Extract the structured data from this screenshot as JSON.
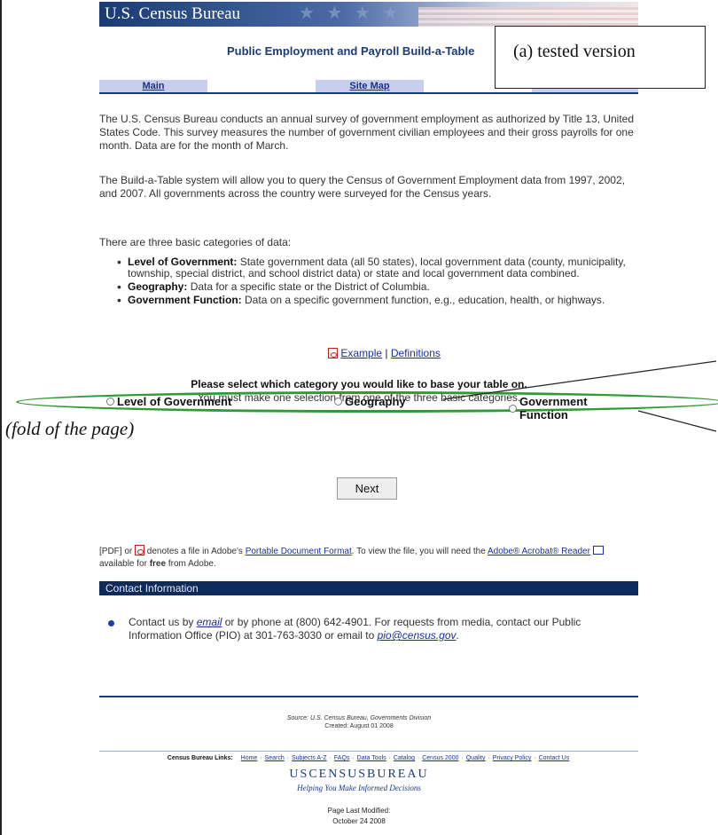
{
  "banner": {
    "title": "U.S. Census Bureau",
    "stars": "★ ★ ★ ★"
  },
  "page_title": "Public Employment and Payroll Build-a-Table",
  "callout": "(a) tested version",
  "nav": {
    "main": "Main",
    "site_map": "Site Map"
  },
  "intro": {
    "p1": "The U.S. Census Bureau conducts an annual survey of government employment as authorized by Title 13, United States Code. This survey measures the number of government civilian employees and their gross payrolls for one month. Data are for the month of March.",
    "p2": "The Build-a-Table system will allow you to query the Census of Government Employment data from 1997, 2002, and 2007. All governments across the country were surveyed for the Census years.",
    "p3": "There are three basic categories of data:"
  },
  "categories": [
    {
      "label": "Level of Government:",
      "text": "State government data (all 50 states), local government data (county, municipality, township, special district, and school district data) or state and local government data combined."
    },
    {
      "label": "Geography:",
      "text": "Data for a specific state or the District of Columbia."
    },
    {
      "label": "Government Function:",
      "text": "Data on a specific government function, e.g., education, health, or highways."
    }
  ],
  "links": {
    "example": "Example",
    "separator": "|",
    "definitions": "Definitions"
  },
  "select": {
    "heading": "Please select which category you would like to base your table on.",
    "sub": "You must make one selection from one of the three basic categories."
  },
  "radios": {
    "level": "Level of Government",
    "geography": "Geography",
    "function": "Government Function"
  },
  "fold_label": "(fold of the page)",
  "next_button": "Next",
  "pdf_note": {
    "prefix": "[PDF] or",
    "mid": "denotes a file in Adobe's",
    "link1": "Portable Document Format",
    "mid2": ". To view the file, you will need the",
    "link2": "Adobe® Acrobat® Reader",
    "suffix_a": "available for",
    "free": "free",
    "suffix_b": "from Adobe."
  },
  "contact": {
    "bar": "Contact Information",
    "t1": "Contact us by",
    "email": "email",
    "t2": "or by phone at (800) 642-4901. For requests from media, contact our Public Information Office (PIO) at 301-763-3030 or email to",
    "pio": "pio@census.gov",
    "t3": "."
  },
  "source": {
    "line1": "Source: U.S. Census Bureau, Governments Division",
    "line2": "Created: August 01 2008"
  },
  "footer": {
    "label": "Census Bureau Links:",
    "links": [
      "Home",
      "Search",
      "Subjects A-Z",
      "FAQs",
      "Data Tools",
      "Catalog",
      "Census 2000",
      "Quality",
      "Privacy Policy",
      "Contact Us"
    ],
    "brand": "USCENSUSBUREAU",
    "tagline": "Helping You Make Informed Decisions",
    "modified_label": "Page Last Modified:",
    "modified_date": "October 24 2008"
  },
  "colors": {
    "navy": "#1b3a7a",
    "ellipse_green": "#2e9b35",
    "contact_bar": "#0e2a5a"
  }
}
